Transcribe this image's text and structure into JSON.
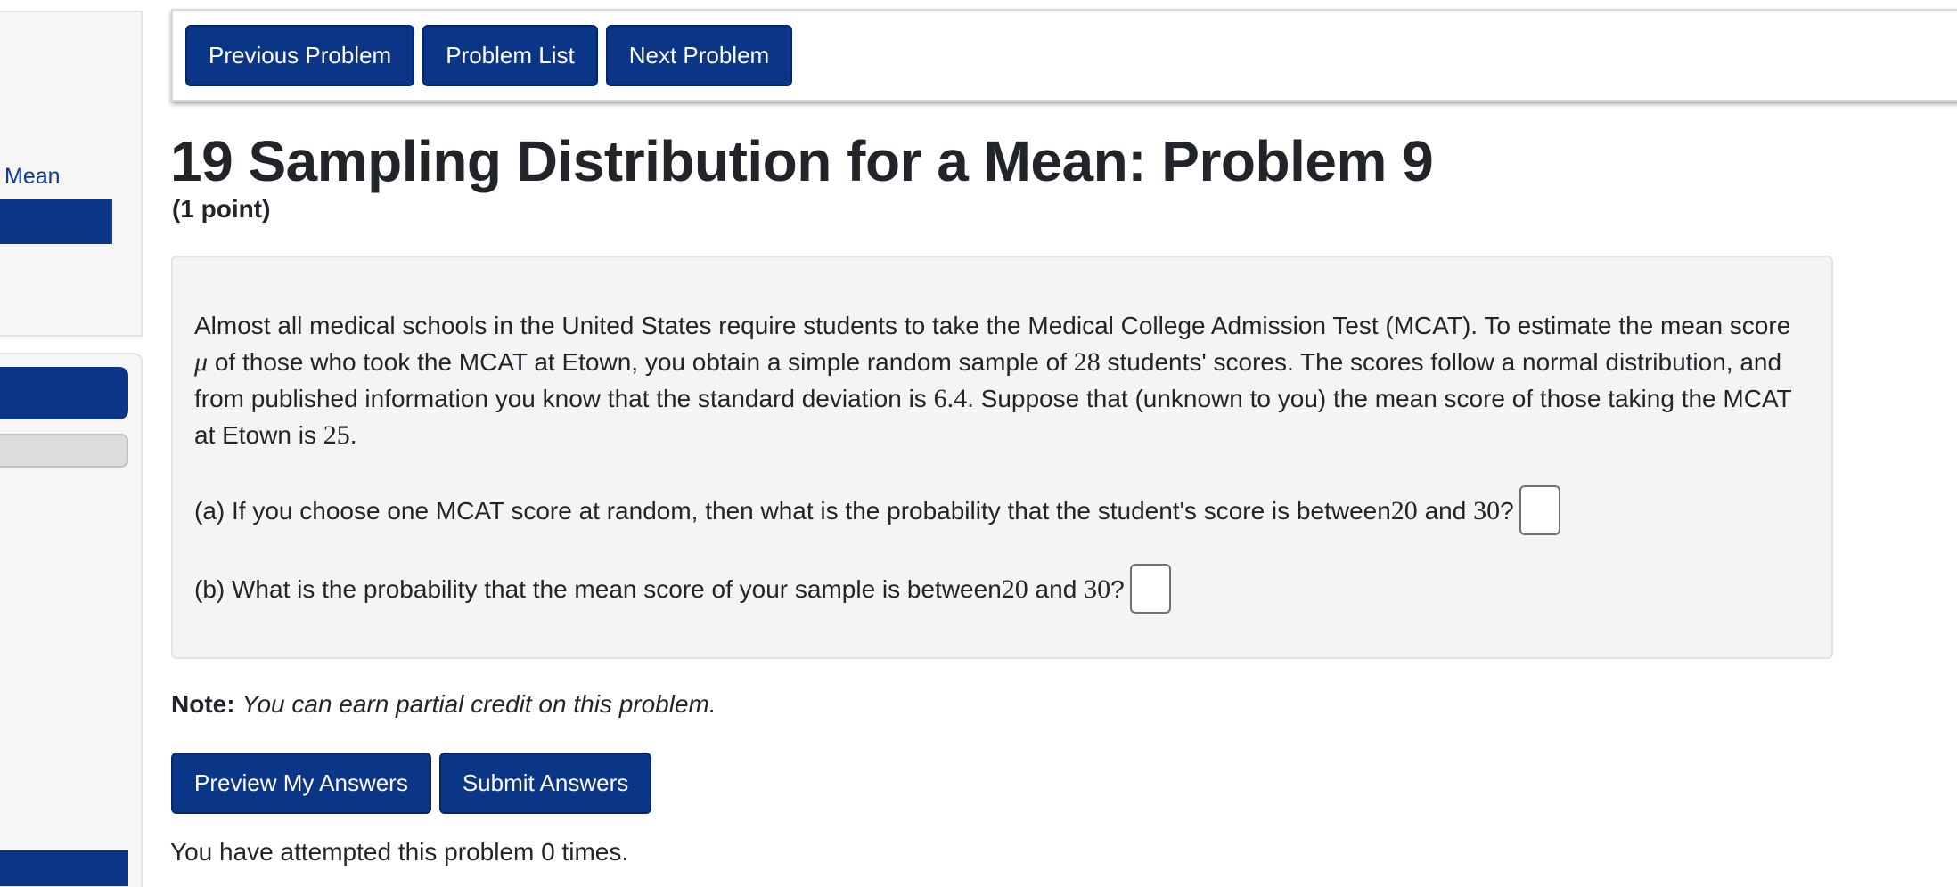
{
  "sidebar": {
    "link_label": "Mean"
  },
  "nav": {
    "previous_label": "Previous Problem",
    "list_label": "Problem List",
    "next_label": "Next Problem"
  },
  "problem": {
    "title": "19 Sampling Distribution for a Mean: Problem 9",
    "points": "(1 point)",
    "intro": {
      "p1": "Almost all medical schools in the United States require students to take the Medical College Admission Test (MCAT). To estimate the mean score ",
      "mu": "μ",
      "p2": " of those who took the MCAT at Etown, you obtain a simple random sample of ",
      "n": "28",
      "p3": " students' scores. The scores follow a normal distribution, and from published information you know that the standard deviation is ",
      "sd": "6.4",
      "p4": ". Suppose that (unknown to you) the mean score of those taking the MCAT at Etown is ",
      "mean": "25",
      "p5": "."
    },
    "part_a": {
      "text": "(a) If you choose one MCAT score at random, then what is the probability that the student's score is between ",
      "low": "20",
      "and": " and ",
      "high": "30",
      "end": "?",
      "value": ""
    },
    "part_b": {
      "text": "(b) What is the probability that the mean score of your sample is between ",
      "low": "20",
      "and": " and ",
      "high": "30",
      "end": "?",
      "value": ""
    }
  },
  "note": {
    "label": "Note:",
    "text": "You can earn partial credit on this problem."
  },
  "actions": {
    "preview_label": "Preview My Answers",
    "submit_label": "Submit Answers"
  },
  "status": {
    "attempts_text": "You have attempted this problem 0 times."
  },
  "colors": {
    "primary": "#0b3688",
    "problem_bg": "#f4f4f4",
    "text": "#212529"
  }
}
